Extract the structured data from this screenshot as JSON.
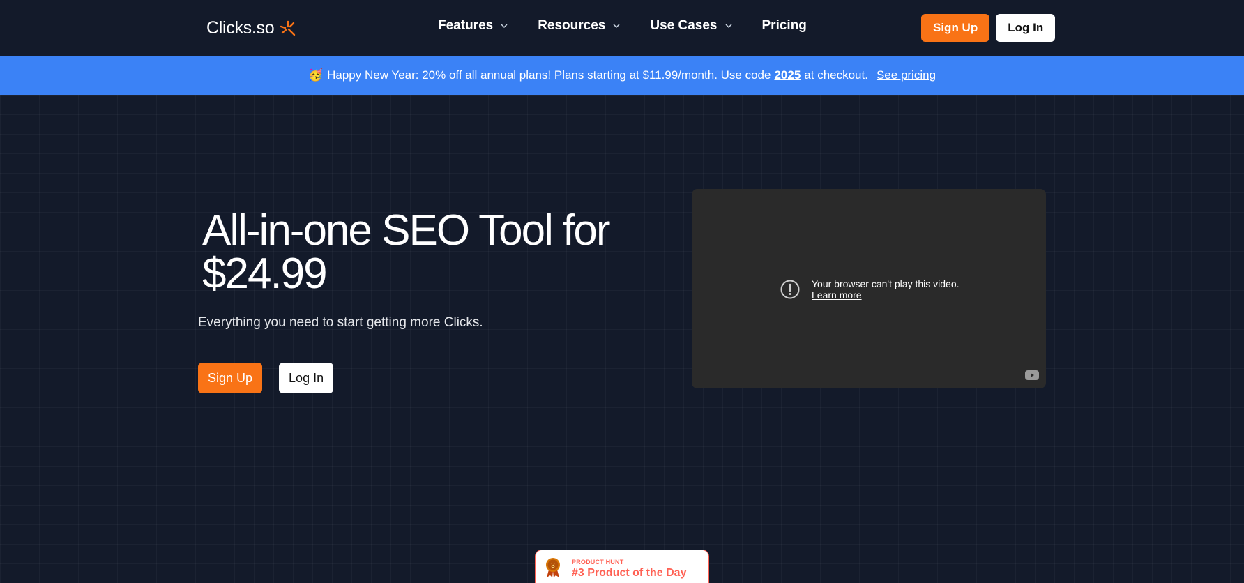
{
  "header": {
    "logo_text": "Clicks.so",
    "nav": [
      {
        "label": "Features",
        "has_dropdown": true
      },
      {
        "label": "Resources",
        "has_dropdown": true
      },
      {
        "label": "Use Cases",
        "has_dropdown": true
      },
      {
        "label": "Pricing",
        "has_dropdown": false
      }
    ],
    "signup_label": "Sign Up",
    "login_label": "Log In"
  },
  "banner": {
    "emoji": "🥳",
    "text_before": "Happy New Year: 20% off all annual plans! Plans starting at $11.99/month. Use code",
    "code": "2025",
    "text_after": "at checkout.",
    "link_label": "See pricing"
  },
  "hero": {
    "title": "All-in-one SEO Tool for $24.99",
    "subtitle": "Everything you need to start getting more Clicks.",
    "signup_label": "Sign Up",
    "login_label": "Log In"
  },
  "video": {
    "error_message": "Your browser can't play this video.",
    "learn_more_label": "Learn more"
  },
  "product_hunt": {
    "small_label": "PRODUCT HUNT",
    "rank_text": "#3 Product of the Day",
    "medal_number": "3"
  },
  "colors": {
    "background": "#131a2a",
    "accent_orange": "#f97316",
    "banner_blue": "#3b82f6",
    "product_hunt_red": "#ff6154"
  },
  "icons": {
    "logo": "sparkle-icon",
    "nav_dropdown": "chevron-down-icon",
    "video_error": "alert-circle-icon",
    "video_brand": "youtube-icon",
    "badge": "medal-icon"
  }
}
